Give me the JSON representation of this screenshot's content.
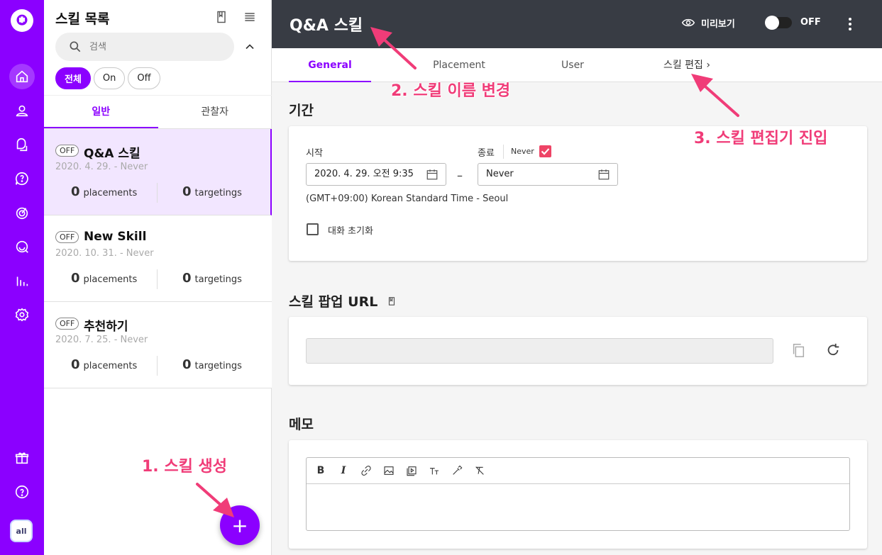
{
  "sidebar": {
    "icons": [
      "logo-icon",
      "home-icon",
      "user-icon",
      "chat-icon",
      "help-bubble-icon",
      "target-icon",
      "search-chat-icon",
      "bar-chart-icon",
      "gear-icon",
      "gift-icon",
      "help-icon"
    ],
    "avatar_text": "all"
  },
  "skill_list": {
    "title": "스킬 목록",
    "search_placeholder": "검색",
    "filters": [
      "전체",
      "On",
      "Off"
    ],
    "tabs": [
      "일반",
      "관찰자"
    ],
    "items": [
      {
        "status": "OFF",
        "name": "Q&A 스킬",
        "date": "2020. 4. 29. - Never",
        "placements": "0",
        "targetings": "0"
      },
      {
        "status": "OFF",
        "name": "New Skill",
        "date": "2020. 10. 31. - Never",
        "placements": "0",
        "targetings": "0"
      },
      {
        "status": "OFF",
        "name": "추천하기",
        "date": "2020. 7. 25. - Never",
        "placements": "0",
        "targetings": "0"
      }
    ],
    "placements_label": "placements",
    "targetings_label": "targetings",
    "fab_label": "+"
  },
  "header": {
    "title": "Q&A 스킬",
    "preview_label": "미리보기",
    "toggle_label": "OFF"
  },
  "tabs": [
    "General",
    "Placement",
    "User",
    "스킬 편집"
  ],
  "period": {
    "title": "기간",
    "start_label": "시작",
    "start_value": "2020. 4. 29. 오전 9:35",
    "dash": "–",
    "end_label": "종료",
    "never_label": "Never",
    "end_value": "Never",
    "timezone": "(GMT+09:00) Korean Standard Time - Seoul",
    "reset_label": "대화 초기화"
  },
  "popup_url": {
    "title": "스킬 팝업 URL"
  },
  "memo": {
    "title": "메모"
  },
  "annotations": [
    "1. 스킬 생성",
    "2. 스킬 이름 변경",
    "3. 스킬 편집기 진입"
  ],
  "colors": {
    "brand": "#8b00ff",
    "header": "#383c44",
    "annotation": "#f03c78"
  }
}
